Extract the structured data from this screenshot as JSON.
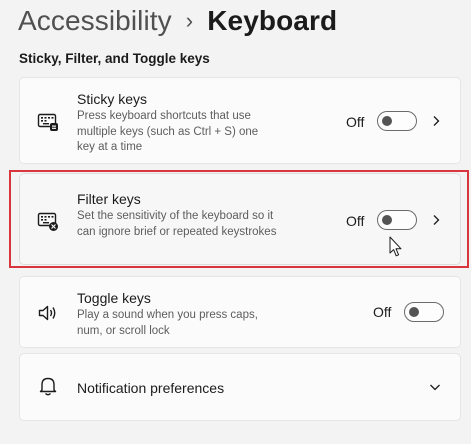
{
  "breadcrumb": {
    "parent": "Accessibility",
    "separator": "›",
    "current": "Keyboard"
  },
  "section": {
    "title": "Sticky, Filter, and Toggle keys"
  },
  "sticky_keys": {
    "title": "Sticky keys",
    "description": "Press keyboard shortcuts that use multiple keys (such as Ctrl + S) one key at a time",
    "state": "Off",
    "toggle_on": false,
    "icon": "keyboard-sticky-icon"
  },
  "filter_keys": {
    "title": "Filter keys",
    "description": "Set the sensitivity of the keyboard so it can ignore brief or repeated keystrokes",
    "state": "Off",
    "toggle_on": false,
    "icon": "keyboard-filter-icon",
    "highlight_color": "#d9353f"
  },
  "toggle_keys": {
    "title": "Toggle keys",
    "description": "Play a sound when you press caps, num, or scroll lock",
    "state": "Off",
    "toggle_on": false,
    "icon": "speaker-icon"
  },
  "notifications": {
    "title": "Notification preferences",
    "icon": "bell-icon"
  }
}
